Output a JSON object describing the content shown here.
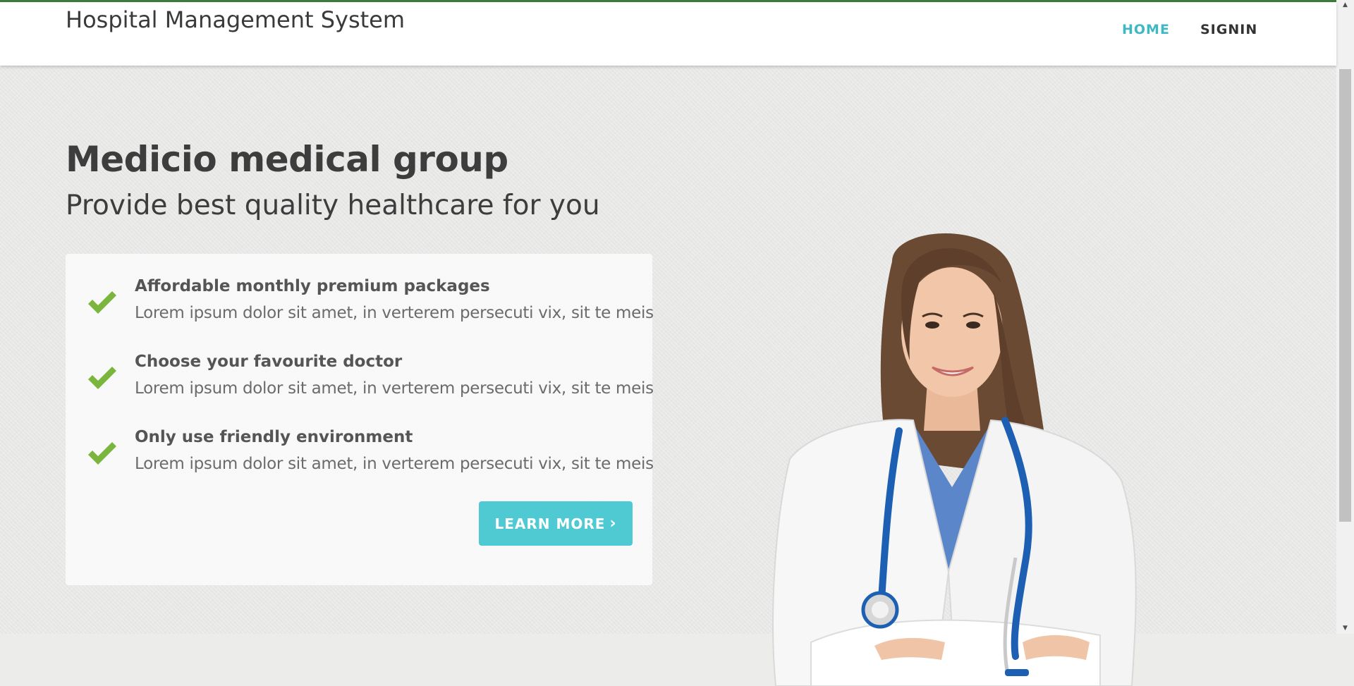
{
  "navbar": {
    "brand": "Hospital Management System",
    "items": [
      {
        "label": "HOME",
        "active": true
      },
      {
        "label": "SIGNIN",
        "active": false
      }
    ]
  },
  "hero": {
    "title": "Medicio medical group",
    "subtitle": "Provide best quality healthcare for you",
    "features": [
      {
        "title": "Affordable monthly premium packages",
        "description": "Lorem ipsum dolor sit amet, in verterem persecuti vix, sit te meis"
      },
      {
        "title": "Choose your favourite doctor",
        "description": "Lorem ipsum dolor sit amet, in verterem persecuti vix, sit te meis"
      },
      {
        "title": "Only use friendly environment",
        "description": "Lorem ipsum dolor sit amet, in verterem persecuti vix, sit te meis"
      }
    ],
    "button_label": "LEARN MORE",
    "button_icon": "chevron-right-icon"
  },
  "colors": {
    "accent": "#4fcad3",
    "nav_active": "#3fb8c4",
    "check": "#7ab53e",
    "top_line": "#3a7d3a"
  }
}
